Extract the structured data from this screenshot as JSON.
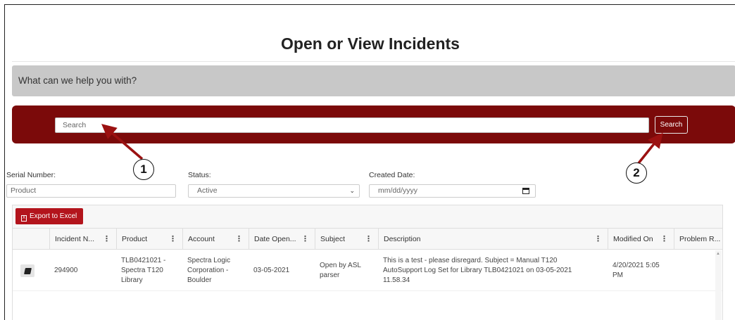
{
  "page": {
    "title": "Open or View Incidents"
  },
  "help": {
    "prompt": "What can we help you with?"
  },
  "search": {
    "placeholder": "Search",
    "button_label": "Search"
  },
  "callouts": [
    "1",
    "2"
  ],
  "filters": {
    "serial": {
      "label": "Serial Number:",
      "placeholder": "Product"
    },
    "status": {
      "label": "Status:",
      "value": "Active"
    },
    "created": {
      "label": "Created Date:",
      "placeholder": "mm/dd/yyyy"
    }
  },
  "grid": {
    "export_label": "Export to Excel",
    "columns": [
      "Incident N...",
      "Product",
      "Account",
      "Date Open...",
      "Subject",
      "Description",
      "Modified On",
      "Problem R..."
    ],
    "rows": [
      {
        "incident": "294900",
        "product": "TLB0421021 - Spectra T120 Library",
        "account": "Spectra Logic Corporation - Boulder",
        "date_opened": "03-05-2021",
        "subject": "Open by ASL parser",
        "description": "This is a test - please disregard. Subject = Manual T120 AutoSupport Log Set for Library TLB0421021 on 03-05-2021 11.58.34",
        "modified_on": "4/20/2021 5:05 PM",
        "problem": ""
      }
    ]
  },
  "colors": {
    "brand_dark_red": "#7b0a0a",
    "export_red": "#b3141c",
    "help_gray": "#c8c8c8",
    "callout_arrow": "#9b1111"
  },
  "icons": [
    "kebab-menu-icon",
    "calendar-icon",
    "chevron-down-icon",
    "edit-icon",
    "excel-icon"
  ]
}
